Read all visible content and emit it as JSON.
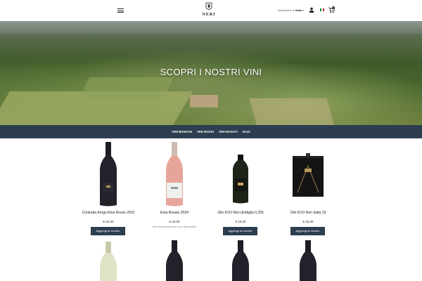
{
  "header": {
    "logo_text": "NERI",
    "shipping_label": "Spedizione in",
    "shipping_country": "Italia",
    "cart_count": "0",
    "flag_colors": [
      "#009246",
      "#ffffff",
      "#ce2b37"
    ]
  },
  "hero": {
    "title": "SCOPRI I NOSTRI VINI"
  },
  "catnav": {
    "items": [
      "VINI BIANCHI",
      "VINI ROSSI",
      "VINI ROSATI",
      "OLIO"
    ]
  },
  "products": [
    {
      "name": "Contrada Arrigo Etna Rosso 2022",
      "price": "€ 22,00",
      "button": "Aggiungi al carrello",
      "note": ""
    },
    {
      "name": "Etna Rosato 2024",
      "price": "€ 24,00",
      "button": "",
      "note": "Momentaneamente non disponibile"
    },
    {
      "name": "Olio EVO Neri (bottiglia 0,25l)",
      "price": "€ 10,00",
      "button": "Aggiungi al carrello",
      "note": ""
    },
    {
      "name": "Olio EVO Neri (latta 2l)",
      "price": "€ 40,00",
      "button": "Aggiungi al carrello",
      "note": ""
    }
  ],
  "colors": {
    "nav_bg": "#2c3e50",
    "button_bg": "#2c3e50"
  }
}
